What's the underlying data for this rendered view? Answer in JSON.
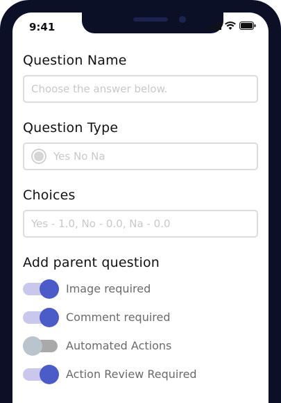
{
  "status_bar": {
    "time": "9:41"
  },
  "question_name": {
    "label": "Question Name",
    "placeholder": "Choose the answer below."
  },
  "question_type": {
    "label": "Question Type",
    "value": "Yes No Na"
  },
  "choices": {
    "label": "Choices",
    "placeholder": "Yes - 1.0, No - 0.0, Na - 0.0"
  },
  "parent": {
    "label": "Add parent question"
  },
  "toggles": [
    {
      "label": "Image required",
      "on": true
    },
    {
      "label": "Comment required",
      "on": true
    },
    {
      "label": "Automated Actions",
      "on": false
    },
    {
      "label": "Action Review Required",
      "on": true
    }
  ],
  "colors": {
    "accent": "#4b5bc8",
    "track_on": "#c9c8ec",
    "track_off": "#a9a9a9",
    "frame": "#0b1026"
  }
}
